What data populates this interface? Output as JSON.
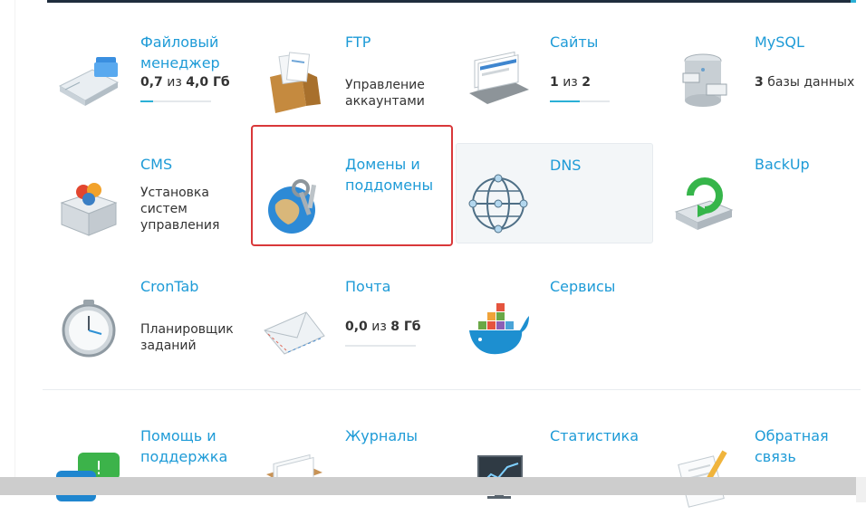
{
  "tiles": [
    {
      "key": "files",
      "title": "Файловый менеджер",
      "used": "0,7",
      "sep": " из ",
      "total": "4,0",
      "unit": " Гб",
      "fill": 0.18
    },
    {
      "key": "ftp",
      "title": "FTP",
      "desc": "Управление аккаунтами"
    },
    {
      "key": "sites",
      "title": "Сайты",
      "used": "1",
      "sep": " из ",
      "total": "2",
      "unit": "",
      "fill": 0.5
    },
    {
      "key": "mysql",
      "title": "MySQL",
      "used": "3",
      "unit": " базы данных"
    },
    {
      "key": "cms",
      "title": "CMS",
      "desc": "Установка систем управления"
    },
    {
      "key": "domains",
      "title": "Домены и поддомены"
    },
    {
      "key": "dns",
      "title": "DNS"
    },
    {
      "key": "backup",
      "title": "BackUp"
    },
    {
      "key": "crontab",
      "title": "CronTab",
      "desc": "Планировщик заданий"
    },
    {
      "key": "mail",
      "title": "Почта",
      "used": "0,0",
      "sep": " из ",
      "total": "8",
      "unit": " Гб",
      "fill": 0.0
    },
    {
      "key": "services",
      "title": "Сервисы"
    },
    {
      "key": "support",
      "title": "Помощь и поддержка"
    },
    {
      "key": "logs",
      "title": "Журналы"
    },
    {
      "key": "stats",
      "title": "Статистика"
    },
    {
      "key": "feedback",
      "title": "Обратная связь"
    }
  ],
  "colors": {
    "link": "#1e9bd7",
    "accent": "#2bb0d6",
    "highlight": "#d9383a"
  }
}
